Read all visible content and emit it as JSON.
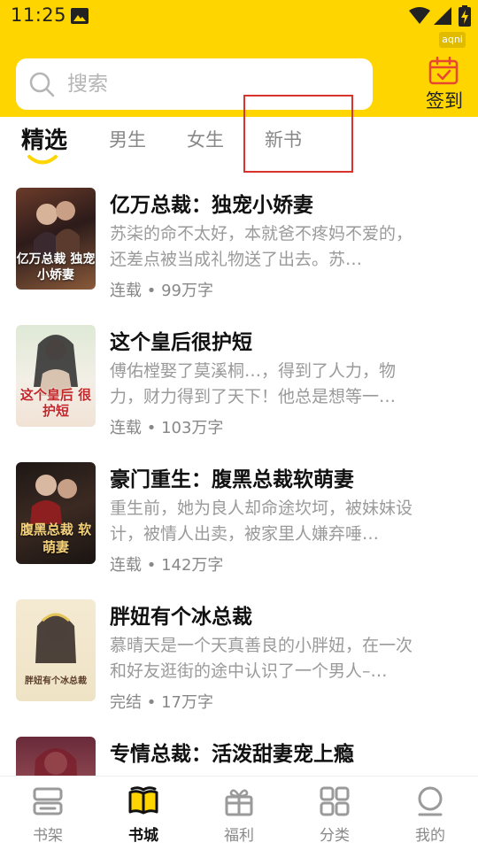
{
  "status_bar": {
    "time": "11:25",
    "badge": "aqni"
  },
  "search": {
    "placeholder": "搜索"
  },
  "signin": {
    "label": "签到"
  },
  "tabs": [
    {
      "label": "精选",
      "active": true
    },
    {
      "label": "男生",
      "active": false
    },
    {
      "label": "女生",
      "active": false
    },
    {
      "label": "新书",
      "active": false
    }
  ],
  "books": [
    {
      "title": "亿万总裁：独宠小娇妻",
      "desc": "苏柒的命不太好，本就爸不疼妈不爱的，还差点被当成礼物送了出去。苏…",
      "status": "连载",
      "words": "99万字",
      "cover_text": "亿万总裁 独宠小娇妻"
    },
    {
      "title": "这个皇后很护短",
      "desc": "傅佑樘娶了莫溪桐…，得到了人力，物力，财力得到了天下！他总是想等一…",
      "status": "连载",
      "words": "103万字",
      "cover_text": "这个皇后 很护短"
    },
    {
      "title": "豪门重生：腹黑总裁软萌妻",
      "desc": "重生前，她为良人却命途坎坷，被妹妹设计，被情人出卖，被家里人嫌弃唾…",
      "status": "连载",
      "words": "142万字",
      "cover_text": "腹黑总裁 软萌妻"
    },
    {
      "title": "胖妞有个冰总裁",
      "desc": "慕晴天是一个天真善良的小胖妞，在一次和好友逛街的途中认识了一个男人–…",
      "status": "完结",
      "words": "17万字",
      "cover_text": "胖妞有个冰总裁"
    },
    {
      "title": "专情总裁：活泼甜妻宠上瘾",
      "desc": "",
      "status": "",
      "words": "",
      "cover_text": ""
    }
  ],
  "nav": [
    {
      "label": "书架",
      "icon": "bookshelf-icon",
      "active": false
    },
    {
      "label": "书城",
      "icon": "bookstore-icon",
      "active": true
    },
    {
      "label": "福利",
      "icon": "gift-icon",
      "active": false
    },
    {
      "label": "分类",
      "icon": "category-icon",
      "active": false
    },
    {
      "label": "我的",
      "icon": "profile-icon",
      "active": false
    }
  ],
  "colors": {
    "accent": "#FFD500",
    "signin_icon": "#e8472f",
    "highlight": "#d9342b"
  }
}
